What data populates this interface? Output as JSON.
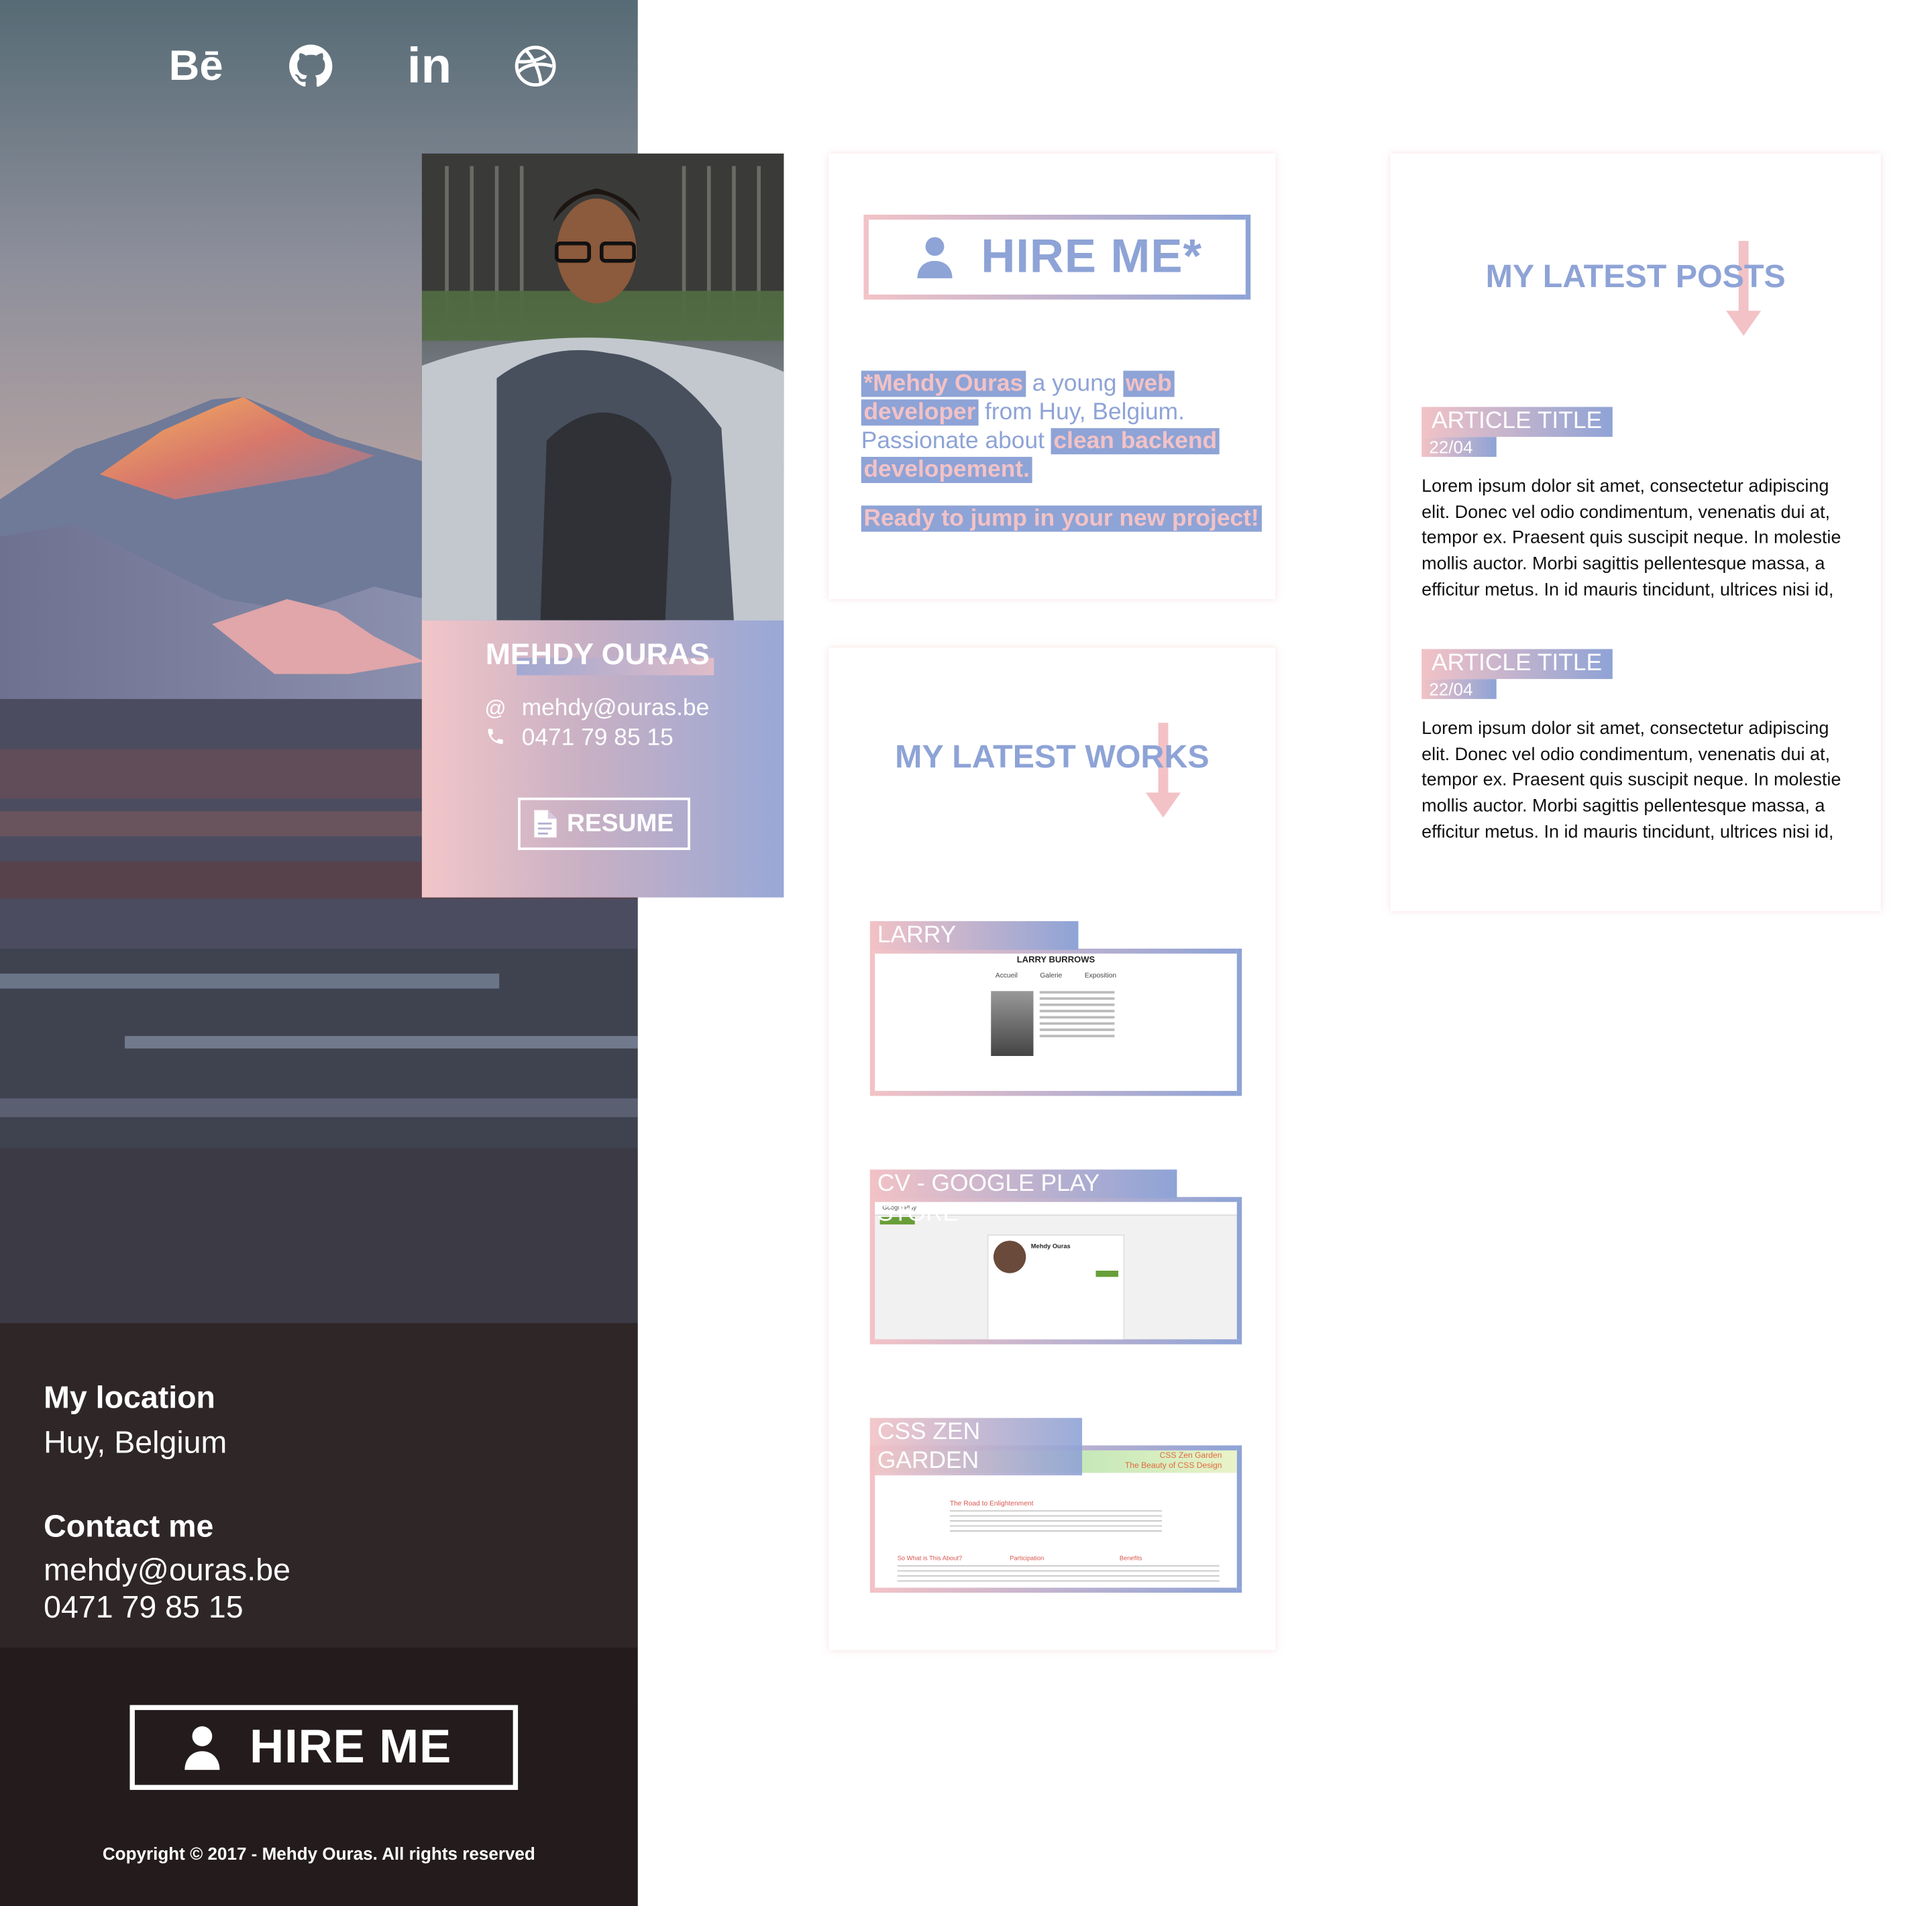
{
  "social": [
    {
      "name": "behance-icon",
      "glyph": "Bē"
    },
    {
      "name": "github-icon",
      "glyph": ""
    },
    {
      "name": "linkedin-icon",
      "glyph": "in"
    },
    {
      "name": "dribbble-icon",
      "glyph": ""
    }
  ],
  "sidebar": {
    "location_heading": "My location",
    "location_value": "Huy, Belgium",
    "contact_heading": "Contact me",
    "contact_email": "mehdy@ouras.be",
    "contact_phone": "0471 79 85 15",
    "hire_label": "HIRE ME",
    "copyright": "Copyright © 2017 - Mehdy Ouras. All rights reserved"
  },
  "profile": {
    "name": "MEHDY OURAS",
    "email_icon": "@",
    "email": "mehdy@ouras.be",
    "phone": "0471 79 85 15",
    "resume_label": "RESUME"
  },
  "hire_card": {
    "button_label": "HIRE ME*",
    "intro_parts": {
      "name": "*Mehdy Ouras",
      "t1": " a young ",
      "web": "web",
      "developer": "developer",
      "t2": " from Huy, Belgium. Passionate about ",
      "clean": "clean backend",
      "dev": "developement.",
      "ready": "Ready to jump in your new project!"
    }
  },
  "works": {
    "title": "MY LATEST WORKS",
    "items": [
      {
        "label": "LARRY",
        "preview_title": "LARRY BURROWS",
        "preview_nav": [
          "Accueil",
          "Galerie",
          "Exposition"
        ]
      },
      {
        "label": "CV - GOOGLE PLAY STORE",
        "preview_title": "Google Play",
        "preview_name": "Mehdy Ouras"
      },
      {
        "label": "CSS ZEN GARDEN",
        "preview_title": "CSS Zen Garden",
        "preview_subtitle": "The Beauty of CSS Design",
        "preview_sections": [
          "The Road to Enlightenment",
          "So What is This About?",
          "Participation",
          "Benefits"
        ]
      }
    ]
  },
  "posts": {
    "title": "MY LATEST POSTS",
    "items": [
      {
        "title": "ARTICLE TITLE",
        "date": "22/04",
        "body": "Lorem ipsum dolor sit amet, consectetur adipiscing elit. Donec vel odio condimentum, venenatis dui at, tempor ex. Praesent quis suscipit neque. In molestie mollis auctor. Morbi sagittis pellentesque massa, a efficitur metus. In id mauris tincidunt, ultrices nisi id,"
      },
      {
        "title": "ARTICLE TITLE",
        "date": "22/04",
        "body": "Lorem ipsum dolor sit amet, consectetur adipiscing elit. Donec vel odio condimentum, venenatis dui at, tempor ex. Praesent quis suscipit neque. In molestie mollis auctor. Morbi sagittis pellentesque massa, a efficitur metus. In id mauris tincidunt, ultrices nisi id,"
      }
    ]
  },
  "colors": {
    "pink": "#f2c2c6",
    "blue": "#8ea3d6"
  }
}
